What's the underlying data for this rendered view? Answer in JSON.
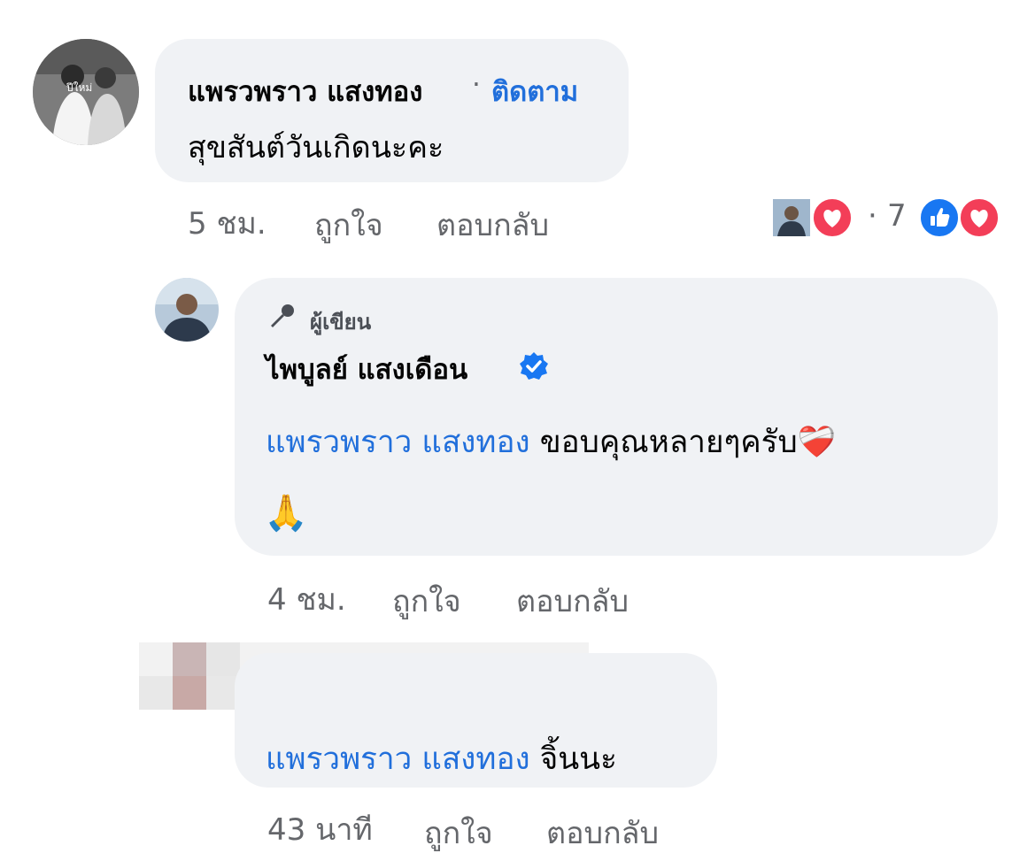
{
  "comment1": {
    "author": "แพรวพราว แสงทอง",
    "separator": "·",
    "follow": "ติดตาม",
    "text": "สุขสันต์วันเกิดนะคะ",
    "avatar_overlay": "ปีใหม่",
    "time": "5 ชม.",
    "like": "ถูกใจ",
    "reply": "ตอบกลับ",
    "reaction_dot": "·",
    "reaction_count": "7"
  },
  "comment2": {
    "badge": "ผู้เขียน",
    "author": "ไพบูลย์ แสงเดือน",
    "mention": "แพรวพราว แสงทอง",
    "text": "ขอบคุณหลายๆครับ",
    "emoji_heart": "❤️‍🩹",
    "emoji_pray": "🙏",
    "time": "4 ชม.",
    "like": "ถูกใจ",
    "reply": "ตอบกลับ"
  },
  "comment3": {
    "mention": "แพรวพราว แสงทอง",
    "text": "จิ้นนะ",
    "time": "43 นาที",
    "like": "ถูกใจ",
    "reply": "ตอบกลับ"
  },
  "colors": {
    "link": "#216fdb",
    "bubble": "#f0f2f5",
    "meta": "#65676b",
    "like_blue": "#1877f2",
    "love_red": "#f33e58"
  },
  "icons": [
    "microphone-icon",
    "verified-badge-icon",
    "like-reaction-icon",
    "love-reaction-icon"
  ]
}
